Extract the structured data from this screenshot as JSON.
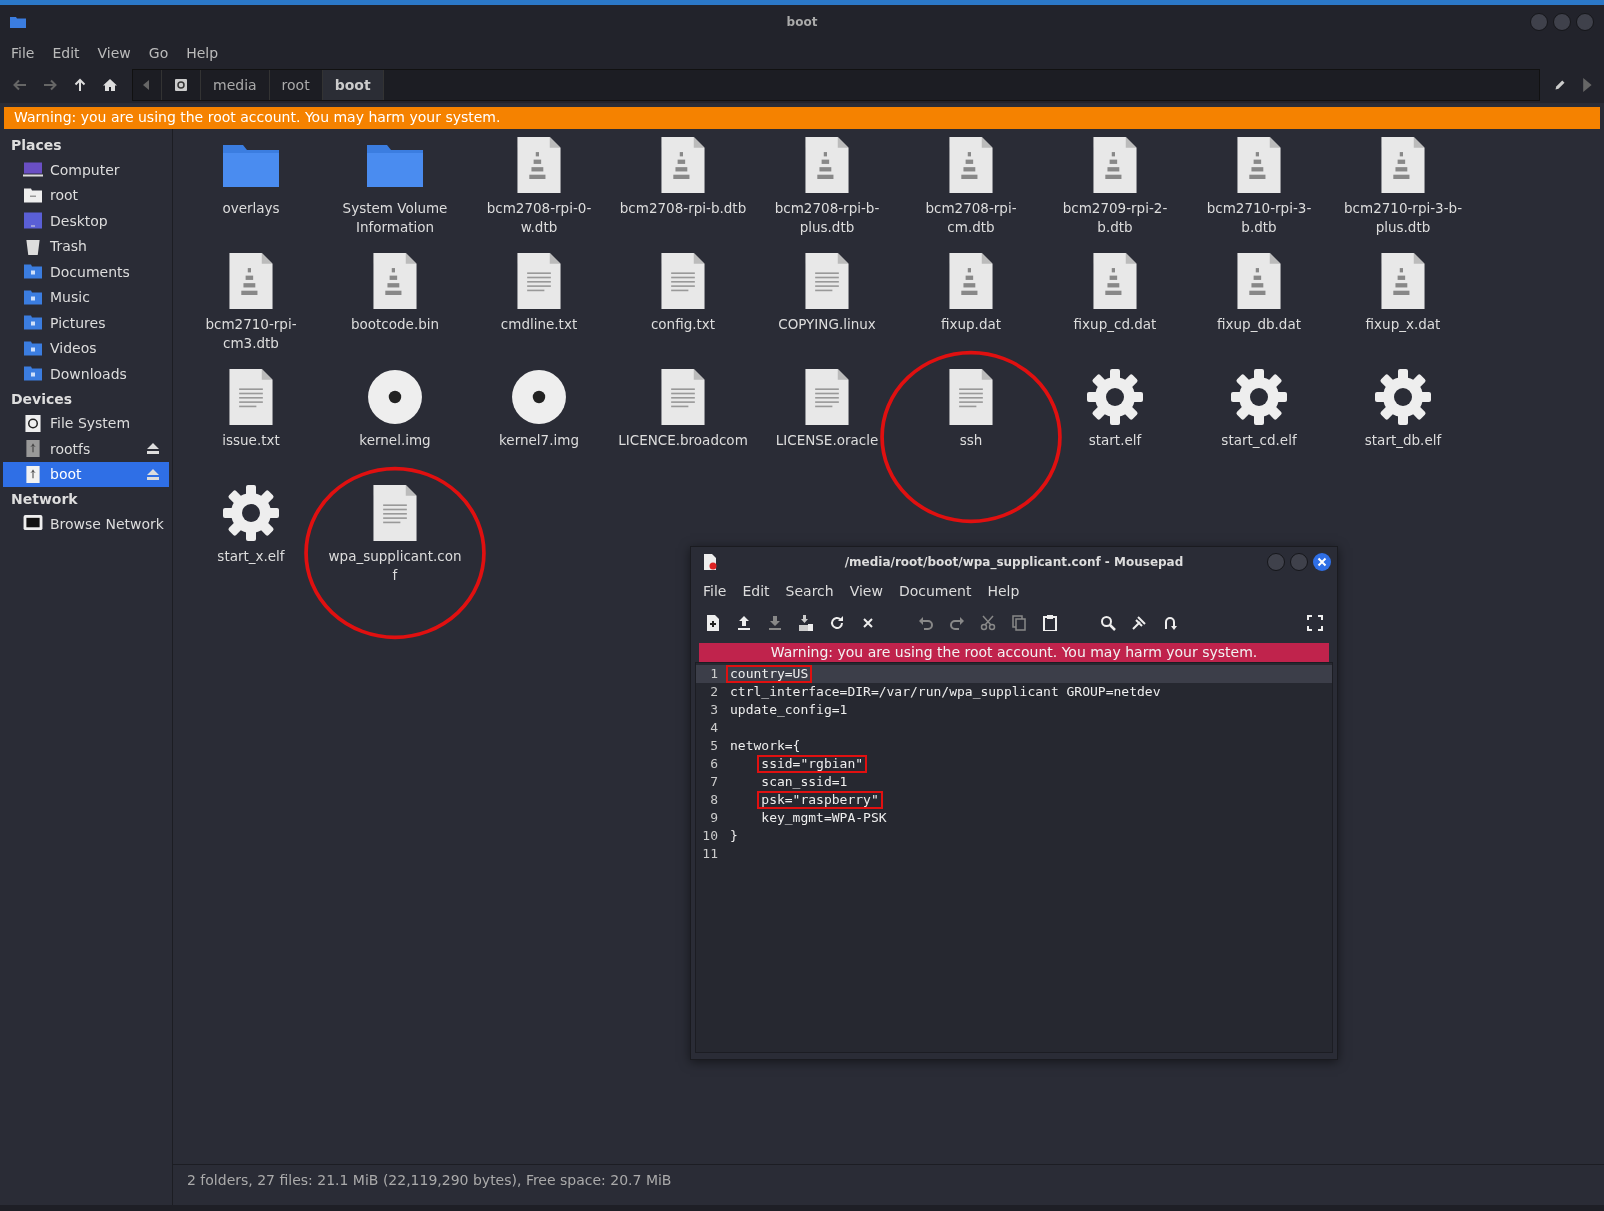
{
  "window": {
    "title": "boot"
  },
  "menu": [
    "File",
    "Edit",
    "View",
    "Go",
    "Help"
  ],
  "path": [
    {
      "label": "media",
      "selected": false
    },
    {
      "label": "root",
      "selected": false
    },
    {
      "label": "boot",
      "selected": true
    }
  ],
  "warning": "Warning: you are using the root account. You may harm your system.",
  "sidebar": [
    {
      "heading": "Places",
      "items": [
        {
          "label": "Computer",
          "kind": "computer",
          "selected": false,
          "eject": false
        },
        {
          "label": "root",
          "kind": "home",
          "selected": false,
          "eject": false
        },
        {
          "label": "Desktop",
          "kind": "desktop",
          "selected": false,
          "eject": false
        },
        {
          "label": "Trash",
          "kind": "trash",
          "selected": false,
          "eject": false
        },
        {
          "label": "Documents",
          "kind": "folder",
          "selected": false,
          "eject": false
        },
        {
          "label": "Music",
          "kind": "folder",
          "selected": false,
          "eject": false
        },
        {
          "label": "Pictures",
          "kind": "folder",
          "selected": false,
          "eject": false
        },
        {
          "label": "Videos",
          "kind": "folder",
          "selected": false,
          "eject": false
        },
        {
          "label": "Downloads",
          "kind": "folder",
          "selected": false,
          "eject": false
        }
      ]
    },
    {
      "heading": "Devices",
      "items": [
        {
          "label": "File System",
          "kind": "disk",
          "selected": false,
          "eject": false
        },
        {
          "label": "rootfs",
          "kind": "usb",
          "selected": false,
          "eject": true
        },
        {
          "label": "boot",
          "kind": "usb",
          "selected": true,
          "eject": true
        }
      ]
    },
    {
      "heading": "Network",
      "items": [
        {
          "label": "Browse Network",
          "kind": "network",
          "selected": false,
          "eject": false
        }
      ]
    }
  ],
  "files": [
    {
      "name": "overlays",
      "kind": "folder",
      "circled": false
    },
    {
      "name": "System Volume Information",
      "kind": "folder",
      "circled": false
    },
    {
      "name": "bcm2708-rpi-0-w.dtb",
      "kind": "binary",
      "circled": false
    },
    {
      "name": "bcm2708-rpi-b.dtb",
      "kind": "binary",
      "circled": false
    },
    {
      "name": "bcm2708-rpi-b-plus.dtb",
      "kind": "binary",
      "circled": false
    },
    {
      "name": "bcm2708-rpi-cm.dtb",
      "kind": "binary",
      "circled": false
    },
    {
      "name": "bcm2709-rpi-2-b.dtb",
      "kind": "binary",
      "circled": false
    },
    {
      "name": "bcm2710-rpi-3-b.dtb",
      "kind": "binary",
      "circled": false
    },
    {
      "name": "bcm2710-rpi-3-b-plus.dtb",
      "kind": "binary",
      "circled": false
    },
    {
      "name": "bcm2710-rpi-cm3.dtb",
      "kind": "binary",
      "circled": false
    },
    {
      "name": "bootcode.bin",
      "kind": "binary",
      "circled": false
    },
    {
      "name": "cmdline.txt",
      "kind": "text",
      "circled": false
    },
    {
      "name": "config.txt",
      "kind": "text",
      "circled": false
    },
    {
      "name": "COPYING.linux",
      "kind": "text",
      "circled": false
    },
    {
      "name": "fixup.dat",
      "kind": "binary",
      "circled": false
    },
    {
      "name": "fixup_cd.dat",
      "kind": "binary",
      "circled": false
    },
    {
      "name": "fixup_db.dat",
      "kind": "binary",
      "circled": false
    },
    {
      "name": "fixup_x.dat",
      "kind": "binary",
      "circled": false
    },
    {
      "name": "issue.txt",
      "kind": "text",
      "circled": false
    },
    {
      "name": "kernel.img",
      "kind": "disc",
      "circled": false
    },
    {
      "name": "kernel7.img",
      "kind": "disc",
      "circled": false
    },
    {
      "name": "LICENCE.broadcom",
      "kind": "text",
      "circled": false
    },
    {
      "name": "LICENSE.oracle",
      "kind": "text",
      "circled": false
    },
    {
      "name": "ssh",
      "kind": "text",
      "circled": true
    },
    {
      "name": "start.elf",
      "kind": "gear",
      "circled": false
    },
    {
      "name": "start_cd.elf",
      "kind": "gear",
      "circled": false
    },
    {
      "name": "start_db.elf",
      "kind": "gear",
      "circled": false
    },
    {
      "name": "start_x.elf",
      "kind": "gear",
      "circled": false
    },
    {
      "name": "wpa_supplicant.conf",
      "kind": "text",
      "circled": true
    }
  ],
  "status_bar": "2 folders, 27 files: 21.1 MiB (22,119,290 bytes), Free space: 20.7 MiB",
  "editor": {
    "title": "/media/root/boot/wpa_supplicant.conf - Mousepad",
    "menu": [
      "File",
      "Edit",
      "Search",
      "View",
      "Document",
      "Help"
    ],
    "warning": "Warning: you are using the root account. You may harm your system.",
    "lines": [
      {
        "number": "1",
        "text": "country=US",
        "highlighted": true,
        "current": true
      },
      {
        "number": "2",
        "text": "ctrl_interface=DIR=/var/run/wpa_supplicant GROUP=netdev",
        "highlighted": false,
        "current": false
      },
      {
        "number": "3",
        "text": "update_config=1",
        "highlighted": false,
        "current": false
      },
      {
        "number": "4",
        "highlighted": false,
        "current": false
      },
      {
        "number": "5",
        "text": "network={",
        "highlighted": false,
        "current": false
      },
      {
        "number": "6",
        "text": "    ssid=\"rgbian\"",
        "highlighted": true,
        "current": false
      },
      {
        "number": "7",
        "text": "    scan_ssid=1",
        "highlighted": false,
        "current": false
      },
      {
        "number": "8",
        "text": "    psk=\"raspberry\"",
        "highlighted": true,
        "current": false
      },
      {
        "number": "9",
        "text": "    key_mgmt=WPA-PSK",
        "highlighted": false,
        "current": false
      },
      {
        "number": "10",
        "text": "}",
        "highlighted": false,
        "current": false
      },
      {
        "number": "11",
        "highlighted": false,
        "current": false
      }
    ]
  }
}
